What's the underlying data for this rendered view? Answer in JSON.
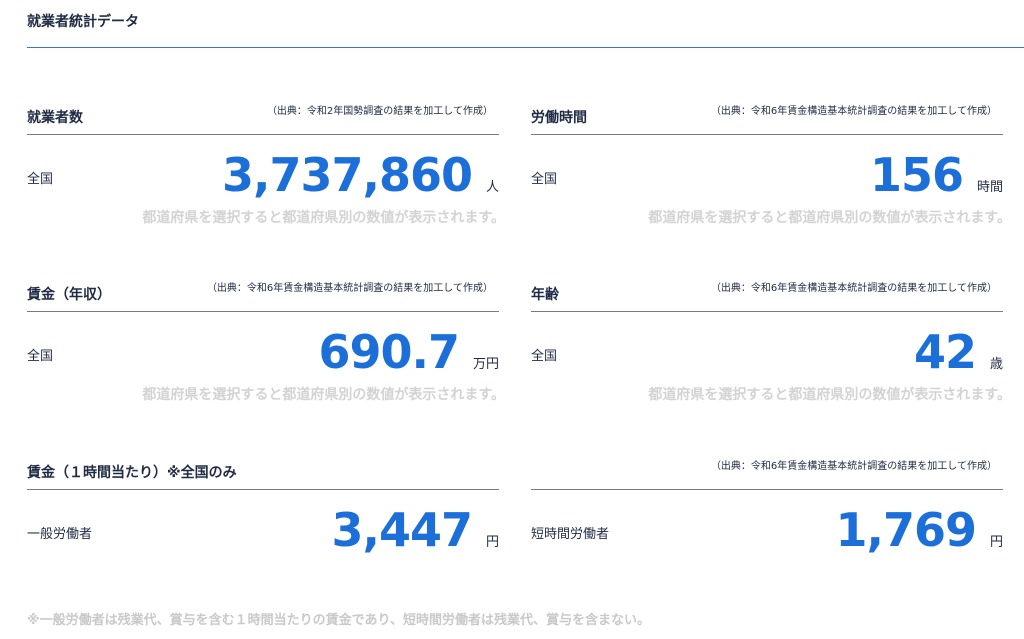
{
  "page": {
    "title": "就業者統計データ"
  },
  "cards": [
    {
      "title": "就業者数",
      "source": "（出典：令和2年国勢調査の結果を加工して作成）",
      "region": "全国",
      "value": "3,737,860",
      "unit": "人",
      "hint": "都道府県を選択すると都道府県別の数値が表示されます。"
    },
    {
      "title": "労働時間",
      "source": "（出典：令和6年賃金構造基本統計調査の結果を加工して作成）",
      "region": "全国",
      "value": "156",
      "unit": "時間",
      "hint": "都道府県を選択すると都道府県別の数値が表示されます。"
    },
    {
      "title": "賃金（年収）",
      "source": "（出典：令和6年賃金構造基本統計調査の結果を加工して作成）",
      "region": "全国",
      "value": "690.7",
      "unit": "万円",
      "hint": "都道府県を選択すると都道府県別の数値が表示されます。"
    },
    {
      "title": "年齢",
      "source": "（出典：令和6年賃金構造基本統計調査の結果を加工して作成）",
      "region": "全国",
      "value": "42",
      "unit": "歳",
      "hint": "都道府県を選択すると都道府県別の数値が表示されます。"
    },
    {
      "title": "賃金（１時間当たり）※全国のみ",
      "source": "",
      "region": "一般労働者",
      "value": "3,447",
      "unit": "円",
      "hint": ""
    },
    {
      "title": "",
      "source": "（出典：令和6年賃金構造基本統計調査の結果を加工して作成）",
      "region": "短時間労働者",
      "value": "1,769",
      "unit": "円",
      "hint": ""
    }
  ],
  "footnote": "※一般労働者は残業代、賞与を含む１時間当たりの賃金であり、短時間労働者は残業代、賞与を含まない。",
  "colors": {
    "accent": "#1c6fd8",
    "rule": "#2f7ad6",
    "hint": "#d3d3d3",
    "text": "#1f2a44"
  }
}
